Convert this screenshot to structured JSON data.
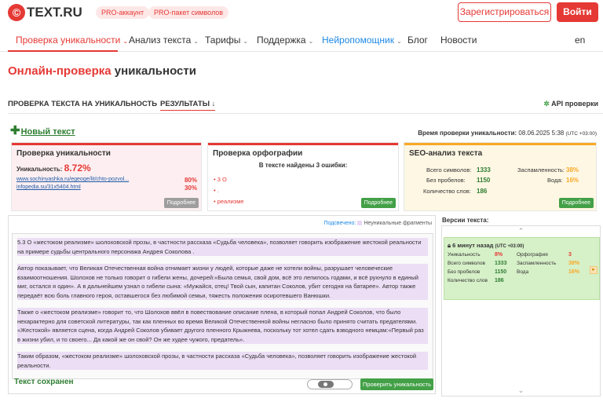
{
  "header": {
    "logo_mark": "©",
    "logo_text": "TEXT.RU",
    "pro_account": "PRO-аккаунт",
    "pro_symbols": "PRO-пакет символов",
    "register": "Зарегистрироваться",
    "login": "Войти"
  },
  "nav": {
    "items": [
      {
        "label": "Проверка уникальности"
      },
      {
        "label": "Анализ текста"
      },
      {
        "label": "Тарифы"
      },
      {
        "label": "Поддержка"
      },
      {
        "label": "Нейропомощник"
      },
      {
        "label": "Блог"
      },
      {
        "label": "Новости"
      }
    ],
    "lang": "en",
    "chevron": "⌄"
  },
  "page": {
    "title_red": "Онлайн-проверка",
    "title_rest": " уникальности",
    "tab_check": "ПРОВЕРКА ТЕКСТА НА УНИКАЛЬНОСТЬ",
    "tab_results": "РЕЗУЛЬТАТЫ ↓",
    "api": "API проверки",
    "new_text": "Новый текст",
    "check_time_label": "Время проверки уникальности:",
    "check_time_value": " 08.06.2025 5:38 ",
    "check_time_tz": "(UTC +03:00)"
  },
  "uniq_card": {
    "title": "Проверка уникальности",
    "label": "Уникальность:",
    "value": "8.72%",
    "sources": [
      {
        "url": "www.sochinyashka.ru/egeoge/lit/chto-pozvol...",
        "value": "80%"
      },
      {
        "url": "infopedia.su/31x5404.html",
        "value": "30%"
      }
    ],
    "more": "Подробнее"
  },
  "spell_card": {
    "title": "Проверка орфографии",
    "found": "В тексте найдены 3 ошибки:",
    "errors": [
      "3 О",
      ".",
      "реализме"
    ],
    "more": "Подробнее"
  },
  "seo_card": {
    "title": "SEO-анализ текста",
    "total_label": "Всего символов:",
    "total": "1333",
    "nospace_label": "Без пробелов:",
    "nospace": "1150",
    "words_label": "Количество слов:",
    "words": "186",
    "spam_label": "Заспамленность:",
    "spam": "38%",
    "water_label": "Вода:",
    "water": "16%",
    "more": "Подробнее"
  },
  "editor": {
    "highlighted": "Подсвечено:",
    "legend": "Неуникальные фрагменты",
    "paragraphs": [
      "5.3 О «жестоком реализме» шолоховской прозы, в частности рассказа «Судьба человека», позволяет говорить изображение жестокой реальности на примере судьбы центрального персонажа Андрея Соколова .",
      "Автор показывает, что Великая Отечественная война отнимает жизни у людей, которые даже не хотели войны, разрушает человеческие взаимоотношения. Шолохов не только говорит о гибели жены, дочерей:«Была семья, свой дом, всё это лепилось годами, и всё рухнуло в единый миг, остался я один». А в дальнейшем узнал о гибели сына: «Мужайся, отец! Твой сын, капитан Соколов, убит сегодня на батарее». Автор также передаёт всю боль главного героя, оставшегося без любимой семьи, тяжесть положения осиротевшего Ванюшки.",
      "Также о «жестоком реализме» говорит то, что Шолохов ввёл в повествование описание плена, в который попал Андрей Соколов, что было нехарактерно для советской литературы, так как пленных во время Великой Отечественной войны негласно было принято считать предателями. «Жестокой» является сцена, когда Андрей Соколов убивает другого пленного Крыжнева, поскольку тот хотел сдать взводного немцам:«Первый раз в жизни убил, и то своего... Да какой же он свой? Он же худее чужого, предатель».",
      "Таким образом, «жестоком реализме» шолоховской прозы, в частности рассказа «Судьба человека», позволяет говорить изображение жестокой реальности."
    ],
    "saved": "Текст сохранен",
    "check_button": "Проверить уникальность"
  },
  "versions": {
    "title": "Версии текста:",
    "item": {
      "time": "6 минут назад",
      "tz": "(UTC +03:00)",
      "uniq_label": "Уникальность",
      "uniq": "8%",
      "total_label": "Всего символов",
      "total": "1333",
      "nospace_label": "Без пробелов",
      "nospace": "1150",
      "words_label": "Количество слов",
      "words": "186",
      "spell_label": "Орфография",
      "spell": "3",
      "spam_label": "Заспамленность",
      "spam": "38%",
      "water_label": "Вода",
      "water": "16%"
    }
  },
  "colors": {
    "accent": "#e53935",
    "green": "#43a047",
    "seo": "#f9a825",
    "highlight": "#ecdef5"
  }
}
